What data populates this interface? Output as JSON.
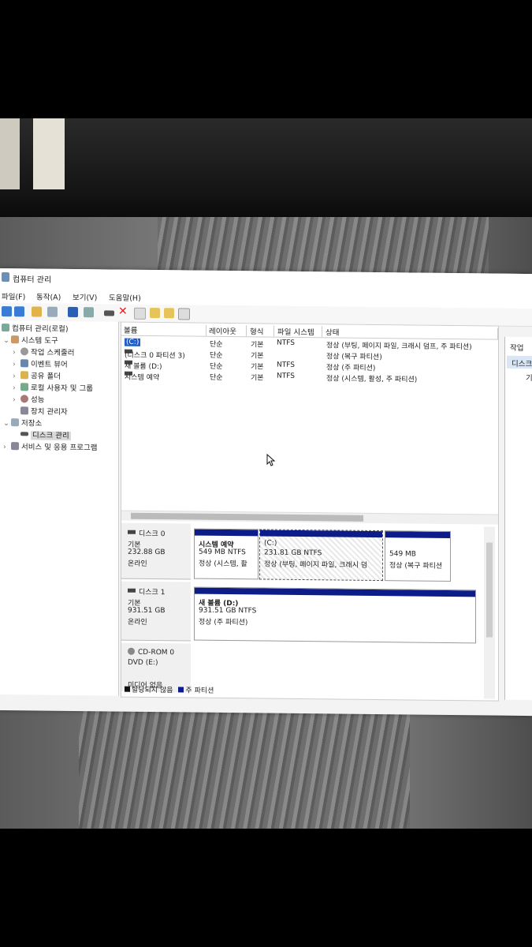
{
  "window": {
    "title": "컴퓨터 관리"
  },
  "menu": [
    "파일(F)",
    "동작(A)",
    "보기(V)",
    "도움말(H)"
  ],
  "tree": {
    "root": "컴퓨터 관리(로컬)",
    "system_tools": "시스템 도구",
    "items": [
      "작업 스케줄러",
      "이벤트 뷰어",
      "공유 폴더",
      "로컬 사용자 및 그룹",
      "성능",
      "장치 관리자"
    ],
    "storage": "저장소",
    "disk_mgmt": "디스크 관리",
    "services": "서비스 및 응용 프로그램"
  },
  "columns": [
    "볼륨",
    "레이아웃",
    "형식",
    "파일 시스템",
    "상태"
  ],
  "volumes": [
    {
      "name": "(C:)",
      "layout": "단순",
      "type": "기본",
      "fs": "NTFS",
      "status": "정상 (부팅, 페이지 파일, 크래시 덤프, 주 파티션)"
    },
    {
      "name": "(디스크 0 파티션 3)",
      "layout": "단순",
      "type": "기본",
      "fs": "",
      "status": "정상 (복구 파티션)"
    },
    {
      "name": "새 볼륨 (D:)",
      "layout": "단순",
      "type": "기본",
      "fs": "NTFS",
      "status": "정상 (주 파티션)"
    },
    {
      "name": "시스템 예약",
      "layout": "단순",
      "type": "기본",
      "fs": "NTFS",
      "status": "정상 (시스템, 활성, 주 파티션)"
    }
  ],
  "disks": [
    {
      "name": "디스크 0",
      "kind": "기본",
      "size": "232.88 GB",
      "state": "온라인",
      "parts": [
        {
          "title": "시스템 예약",
          "size": "549 MB NTFS",
          "status": "정상 (시스템, 활"
        },
        {
          "title": "(C:)",
          "size": "231.81 GB NTFS",
          "status": "정상 (부팅, 페이지 파일, 크래시 덤"
        },
        {
          "title": "",
          "size": "549 MB",
          "status": "정상 (복구 파티션"
        }
      ]
    },
    {
      "name": "디스크 1",
      "kind": "기본",
      "size": "931.51 GB",
      "state": "온라인",
      "parts": [
        {
          "title": "새 볼륨 (D:)",
          "size": "931.51 GB NTFS",
          "status": "정상 (주 파티션)"
        }
      ]
    },
    {
      "name": "CD-ROM 0",
      "kind": "DVD (E:)",
      "size": "",
      "state": "미디어 없음",
      "parts": []
    }
  ],
  "legend": {
    "unallocated": "할당되지 않음",
    "primary": "주 파티션"
  },
  "actions": {
    "header": "작업",
    "selected": "디스크",
    "sub": "기"
  },
  "colors": {
    "partition_bar": "#0c1d8a",
    "selection": "#d9e6f5"
  }
}
